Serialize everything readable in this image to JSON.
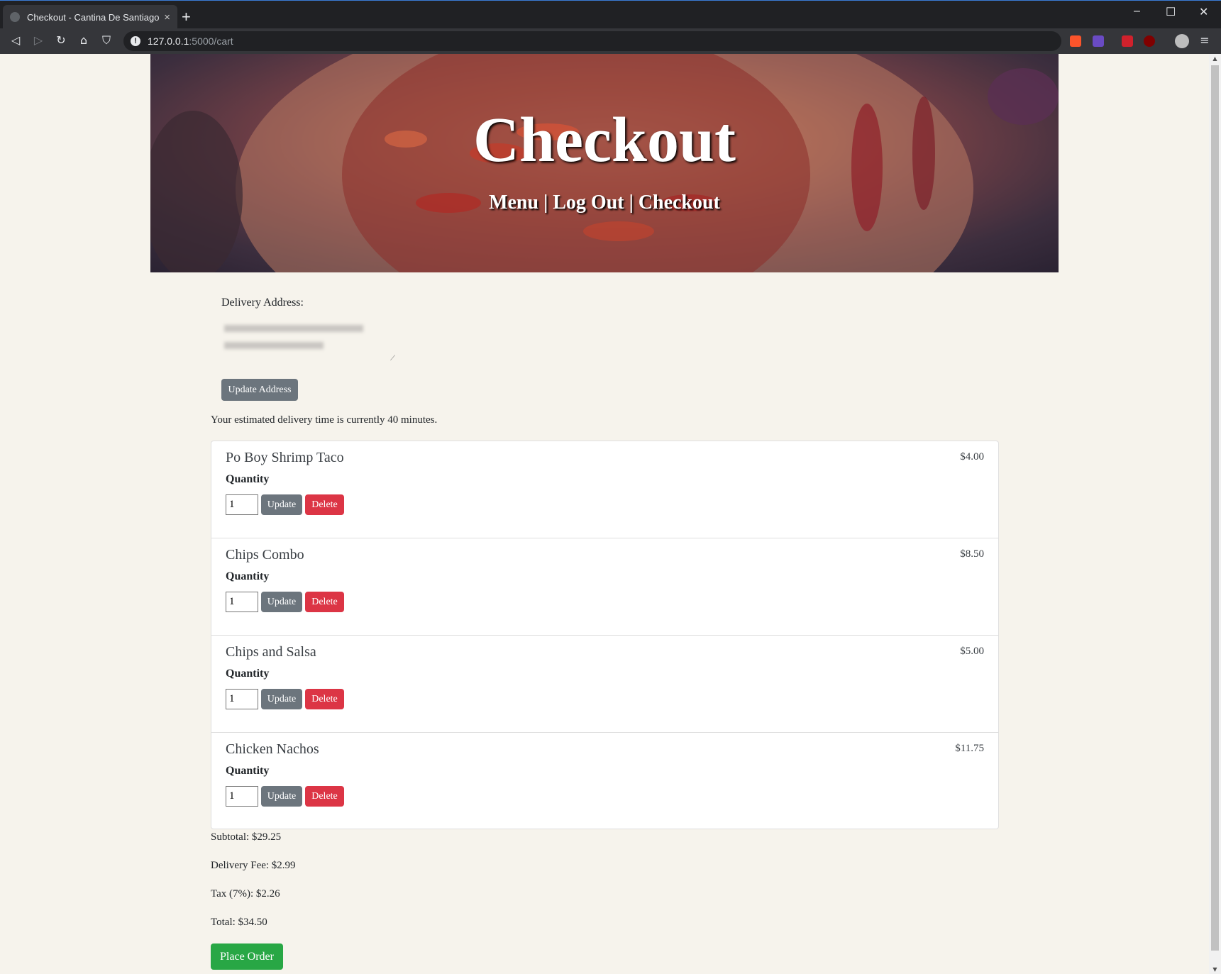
{
  "browser": {
    "tab_title": "Checkout - Cantina De Santiago",
    "tab_close": "×",
    "new_tab": "+",
    "url_host": "127.0.0.1",
    "url_path": ":5000/cart",
    "window_controls": [
      "–",
      "☐",
      "✕"
    ]
  },
  "header": {
    "title": "Checkout",
    "nav": [
      {
        "label": "Menu"
      },
      {
        "label": "Log Out"
      },
      {
        "label": "Checkout"
      }
    ],
    "separator": " | "
  },
  "address": {
    "label": "Delivery Address:",
    "update_button": "Update Address"
  },
  "delivery_note": "Your estimated delivery time is currently 40 minutes.",
  "cart": {
    "quantity_label": "Quantity",
    "update_label": "Update",
    "delete_label": "Delete",
    "items": [
      {
        "name": "Po Boy Shrimp Taco",
        "price": "$4.00",
        "quantity": "1"
      },
      {
        "name": "Chips Combo",
        "price": "$8.50",
        "quantity": "1"
      },
      {
        "name": "Chips and Salsa",
        "price": "$5.00",
        "quantity": "1"
      },
      {
        "name": "Chicken Nachos",
        "price": "$11.75",
        "quantity": "1"
      }
    ]
  },
  "summary": {
    "subtotal": "Subtotal: $29.25",
    "delivery_fee": "Delivery Fee: $2.99",
    "tax": "Tax (7%): $2.26",
    "total": "Total: $34.50",
    "place_order": "Place Order"
  },
  "colors": {
    "page_bg": "#f6f3ec",
    "secondary": "#6c757d",
    "danger": "#dc3545",
    "success": "#28a745"
  }
}
